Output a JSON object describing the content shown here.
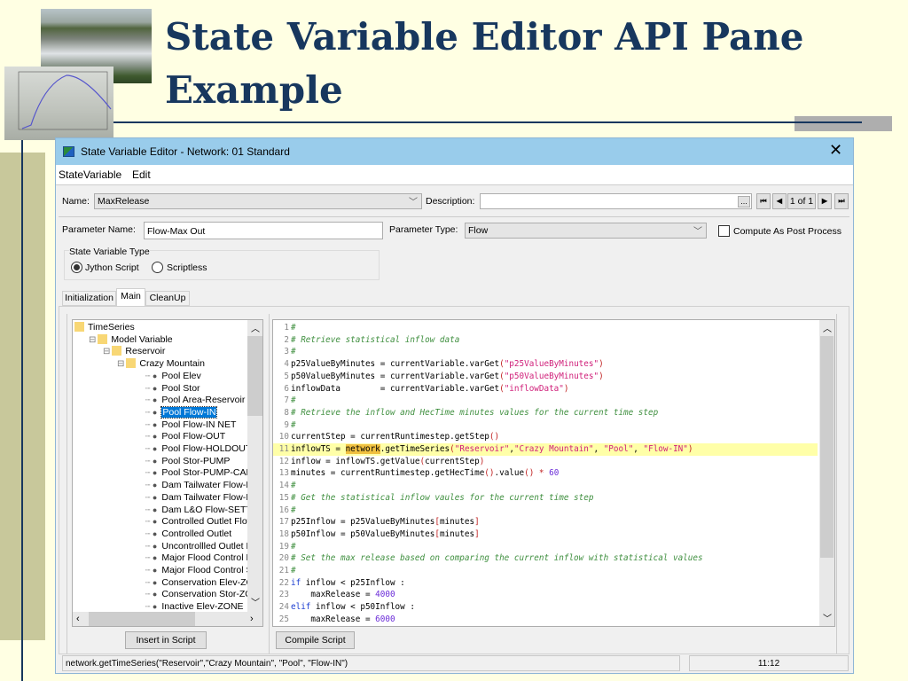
{
  "slide": {
    "title_line1": "State Variable Editor API Pane",
    "title_line2": "Example",
    "colors": {
      "title": "#17375E",
      "background": "#FFFFE3",
      "accent_bar": "#C8C89B"
    }
  },
  "window": {
    "title": "State Variable Editor - Network: 01 Standard",
    "close_icon": "close-icon"
  },
  "menu": [
    "StateVariable",
    "Edit"
  ],
  "form": {
    "name_label": "Name:",
    "name_value": "MaxRelease",
    "description_label": "Description:",
    "description_value": "",
    "ellipsis": "...",
    "record_nav": "1 of 1",
    "parameter_name_label": "Parameter Name:",
    "parameter_name_value": "Flow-Max Out",
    "parameter_type_label": "Parameter Type:",
    "parameter_type_value": "Flow",
    "compute_post_label": "Compute As Post Process",
    "compute_post_checked": false,
    "type_group_label": "State Variable Type",
    "radio_jython": "Jython Script",
    "radio_scriptless": "Scriptless",
    "selected_type": "Jython Script"
  },
  "tabs": [
    {
      "label": "Initialization"
    },
    {
      "label": "Main",
      "selected": true
    },
    {
      "label": "CleanUp"
    }
  ],
  "tree": {
    "items": [
      {
        "label": "TimeSeries",
        "level": 0,
        "type": "folder"
      },
      {
        "label": "Model Variable",
        "level": 1,
        "type": "folder"
      },
      {
        "label": "Reservoir",
        "level": 2,
        "type": "folder"
      },
      {
        "label": "Crazy Mountain",
        "level": 3,
        "type": "folder"
      },
      {
        "label": "Pool Elev",
        "level": 4,
        "type": "leaf"
      },
      {
        "label": "Pool Stor",
        "level": 4,
        "type": "leaf"
      },
      {
        "label": "Pool Area-Reservoir",
        "level": 4,
        "type": "leaf"
      },
      {
        "label": "Pool Flow-IN",
        "level": 4,
        "type": "leaf",
        "selected": true
      },
      {
        "label": "Pool Flow-IN NET",
        "level": 4,
        "type": "leaf"
      },
      {
        "label": "Pool Flow-OUT",
        "level": 4,
        "type": "leaf"
      },
      {
        "label": "Pool Flow-HOLDOUT",
        "level": 4,
        "type": "leaf"
      },
      {
        "label": "Pool Stor-PUMP",
        "level": 4,
        "type": "leaf"
      },
      {
        "label": "Pool Stor-PUMP-CAP",
        "level": 4,
        "type": "leaf"
      },
      {
        "label": "Dam Tailwater Flow-IN",
        "level": 4,
        "type": "leaf"
      },
      {
        "label": "Dam Tailwater Flow-IN",
        "level": 4,
        "type": "leaf"
      },
      {
        "label": "Dam L&O Flow-SETTIN",
        "level": 4,
        "type": "leaf"
      },
      {
        "label": "Controlled Outlet Flow-S",
        "level": 4,
        "type": "leaf"
      },
      {
        "label": "Controlled Outlet",
        "level": 4,
        "type": "leaf"
      },
      {
        "label": "Uncontrollled Outlet Flo",
        "level": 4,
        "type": "leaf"
      },
      {
        "label": "Major Flood Control Ele",
        "level": 4,
        "type": "leaf"
      },
      {
        "label": "Major Flood Control Sto",
        "level": 4,
        "type": "leaf"
      },
      {
        "label": "Conservation Elev-ZONI",
        "level": 4,
        "type": "leaf"
      },
      {
        "label": "Conservation Stor-ZONE",
        "level": 4,
        "type": "leaf"
      },
      {
        "label": "Inactive Elev-ZONE",
        "level": 4,
        "type": "leaf"
      }
    ]
  },
  "code": {
    "lines": [
      [
        [
          "cm",
          "#"
        ]
      ],
      [
        [
          "cm",
          "# Retrieve statistical inflow data"
        ]
      ],
      [
        [
          "cm",
          "#"
        ]
      ],
      [
        [
          "",
          "p25ValueByMinutes = currentVariable.varGet"
        ],
        [
          "pn",
          "("
        ],
        [
          "st",
          "\"p25ValueByMinutes\""
        ],
        [
          "pn",
          ")"
        ]
      ],
      [
        [
          "",
          "p50ValueByMinutes = currentVariable.varGet"
        ],
        [
          "pn",
          "("
        ],
        [
          "st",
          "\"p50ValueByMinutes\""
        ],
        [
          "pn",
          ")"
        ]
      ],
      [
        [
          "",
          "inflowData        = currentVariable.varGet"
        ],
        [
          "pn",
          "("
        ],
        [
          "st",
          "\"inflowData\""
        ],
        [
          "pn",
          ")"
        ]
      ],
      [
        [
          "cm",
          "#"
        ]
      ],
      [
        [
          "cm",
          "# Retrieve the inflow and HecTime minutes values for the current time step"
        ]
      ],
      [
        [
          "cm",
          "#"
        ]
      ],
      [
        [
          "",
          "currentStep = currentRuntimestep.getStep"
        ],
        [
          "pn",
          "()"
        ]
      ],
      [
        [
          "",
          "inflowTS = "
        ],
        [
          "hi",
          "network"
        ],
        [
          "",
          ".getTimeSeries"
        ],
        [
          "pn",
          "("
        ],
        [
          "st",
          "\"Reservoir\""
        ],
        [
          "",
          ","
        ],
        [
          "st",
          "\"Crazy Mountain\""
        ],
        [
          "",
          ", "
        ],
        [
          "st",
          "\"Pool\""
        ],
        [
          "",
          ", "
        ],
        [
          "st",
          "\"Flow-IN\""
        ],
        [
          "pn",
          ")"
        ]
      ],
      [
        [
          "",
          "inflow = inflowTS.getValue"
        ],
        [
          "pn",
          "("
        ],
        [
          "",
          "currentStep"
        ],
        [
          "pn",
          ")"
        ]
      ],
      [
        [
          "",
          "minutes = currentRuntimestep.getHecTime"
        ],
        [
          "pn",
          "()"
        ],
        [
          "",
          ".value"
        ],
        [
          "pn",
          "()"
        ],
        [
          "pn",
          " * "
        ],
        [
          "nm",
          "60"
        ]
      ],
      [
        [
          "cm",
          "#"
        ]
      ],
      [
        [
          "cm",
          "# Get the statistical inflow vaules for the current time step"
        ]
      ],
      [
        [
          "cm",
          "#"
        ]
      ],
      [
        [
          "",
          "p25Inflow = p25ValueByMinutes"
        ],
        [
          "pn",
          "["
        ],
        [
          "",
          "minutes"
        ],
        [
          "pn",
          "]"
        ]
      ],
      [
        [
          "",
          "p50Inflow = p50ValueByMinutes"
        ],
        [
          "pn",
          "["
        ],
        [
          "",
          "minutes"
        ],
        [
          "pn",
          "]"
        ]
      ],
      [
        [
          "cm",
          "#"
        ]
      ],
      [
        [
          "cm",
          "# Set the max release based on comparing the current inflow with statistical values"
        ]
      ],
      [
        [
          "cm",
          "#"
        ]
      ],
      [
        [
          "kw",
          "if"
        ],
        [
          "",
          " inflow < p25Inflow :"
        ]
      ],
      [
        [
          "",
          "    maxRelease = "
        ],
        [
          "nm",
          "4000"
        ]
      ],
      [
        [
          "kw",
          "elif"
        ],
        [
          "",
          " inflow < p50Inflow :"
        ]
      ],
      [
        [
          "",
          "    maxRelease = "
        ],
        [
          "nm",
          "6000"
        ]
      ]
    ],
    "highlighted_line": 11
  },
  "buttons": {
    "insert": "Insert in Script",
    "compile": "Compile Script"
  },
  "status": {
    "text": "network.getTimeSeries(\"Reservoir\",\"Crazy Mountain\", \"Pool\", \"Flow-IN\")",
    "position": "11:12"
  }
}
